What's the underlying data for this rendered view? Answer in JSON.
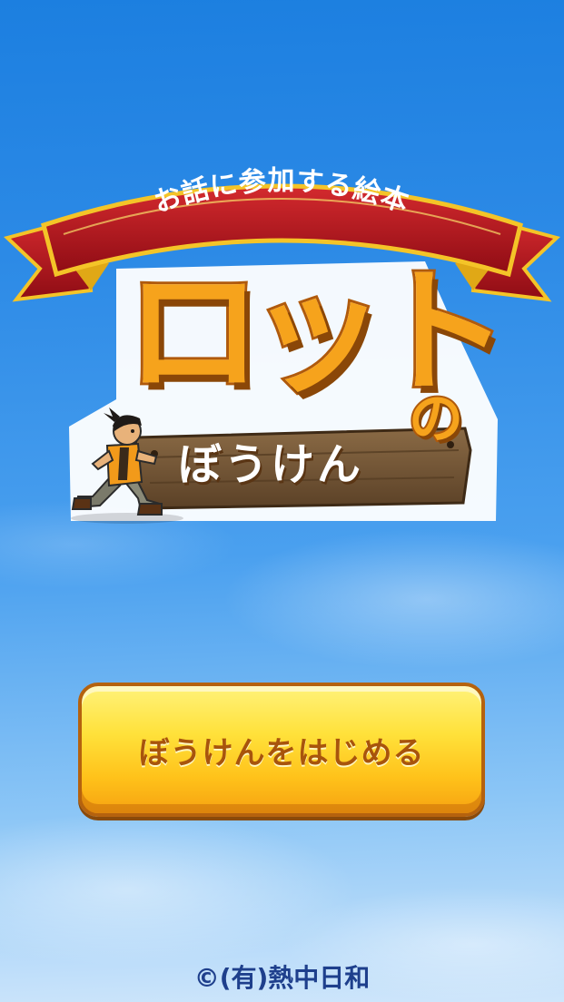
{
  "screen": {
    "name": "title-screen"
  },
  "ribbon": {
    "tagline": "お話に参加する絵本"
  },
  "title": {
    "main": "ロット",
    "particle": "の",
    "sub": "ぼうけん"
  },
  "start_button": {
    "label": "ぼうけんをはじめる"
  },
  "footer": {
    "copyright": "©(有)熱中日和"
  },
  "colors": {
    "sky_top": "#1c7fe0",
    "sky_bottom": "#cfe6fb",
    "ribbon_red": "#b0141e",
    "ribbon_gold": "#f4c428",
    "title_orange": "#f6a31c",
    "button_yellow": "#ffd22a",
    "button_text": "#a8540c",
    "copyright_blue": "#1e3f8c"
  },
  "icons": [
    "ribbon-banner",
    "wooden-sign",
    "running-boy-character"
  ]
}
